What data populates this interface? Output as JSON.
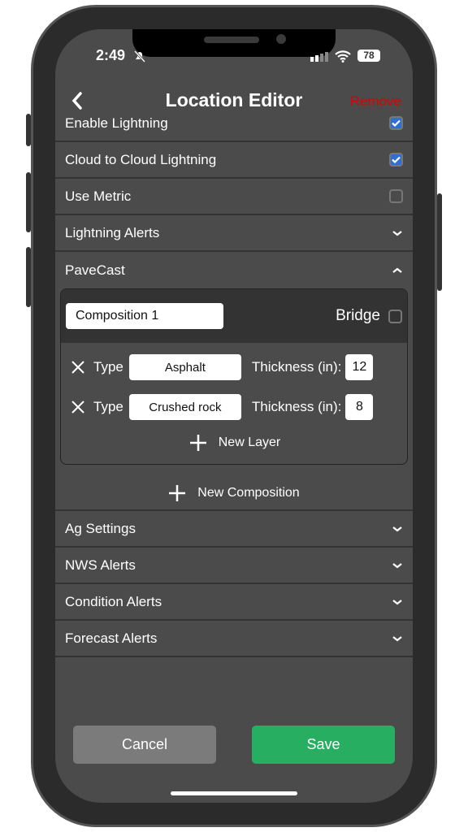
{
  "status": {
    "time": "2:49",
    "battery": "78"
  },
  "header": {
    "title": "Location Editor",
    "remove": "Remove",
    "remove_color": "#e00000"
  },
  "rows": [
    {
      "label": "Enable Lightning",
      "control": "checkbox",
      "checked": true
    },
    {
      "label": "Cloud to Cloud Lightning",
      "control": "checkbox",
      "checked": true
    },
    {
      "label": "Use Metric",
      "control": "checkbox",
      "checked": false
    },
    {
      "label": "Lightning Alerts",
      "control": "chevron-down"
    },
    {
      "label": "PaveCast",
      "control": "chevron-up"
    }
  ],
  "composition": {
    "name": "Composition 1",
    "bridge_label": "Bridge",
    "bridge_checked": false,
    "layers": [
      {
        "type_label": "Type",
        "type": "Asphalt",
        "thickness_label": "Thickness (in):",
        "thickness": "12"
      },
      {
        "type_label": "Type",
        "type": "Crushed rock",
        "thickness_label": "Thickness (in):",
        "thickness": "8"
      }
    ],
    "new_layer": "New Layer"
  },
  "new_composition": "New Composition",
  "sections": [
    "Ag Settings",
    "NWS Alerts",
    "Condition Alerts",
    "Forecast Alerts"
  ],
  "buttons": {
    "cancel": "Cancel",
    "save": "Save",
    "cancel_color": "#7b7b7b",
    "save_color": "#27ae60"
  }
}
